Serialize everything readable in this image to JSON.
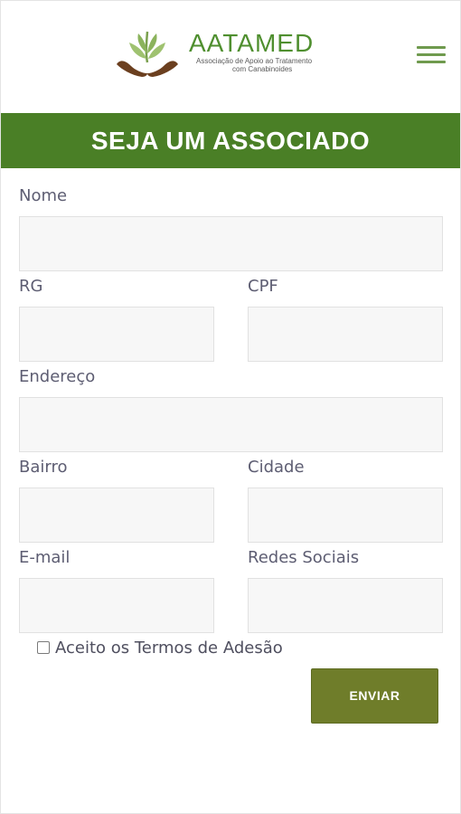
{
  "header": {
    "logo_name": "AATAMED",
    "logo_tagline_line1": "Associação de Apoio ao Tratamento",
    "logo_tagline_line2": "com Canabinoides",
    "menu_icon": "hamburger-menu-icon"
  },
  "banner": {
    "title": "SEJA UM ASSOCIADO"
  },
  "form": {
    "nome_label": "Nome",
    "rg_label": "RG",
    "cpf_label": "CPF",
    "endereco_label": "Endereço",
    "bairro_label": "Bairro",
    "cidade_label": "Cidade",
    "email_label": "E-mail",
    "redes_label": "Redes Sociais",
    "terms_label": "Aceito os Termos de Adesão",
    "terms_checked": false,
    "submit_label": "ENVIAR"
  },
  "colors": {
    "brand_green": "#4a7f26",
    "button_olive": "#6f7d2a",
    "logo_green": "#4f8f2f",
    "hand_brown": "#6b3f1f"
  }
}
